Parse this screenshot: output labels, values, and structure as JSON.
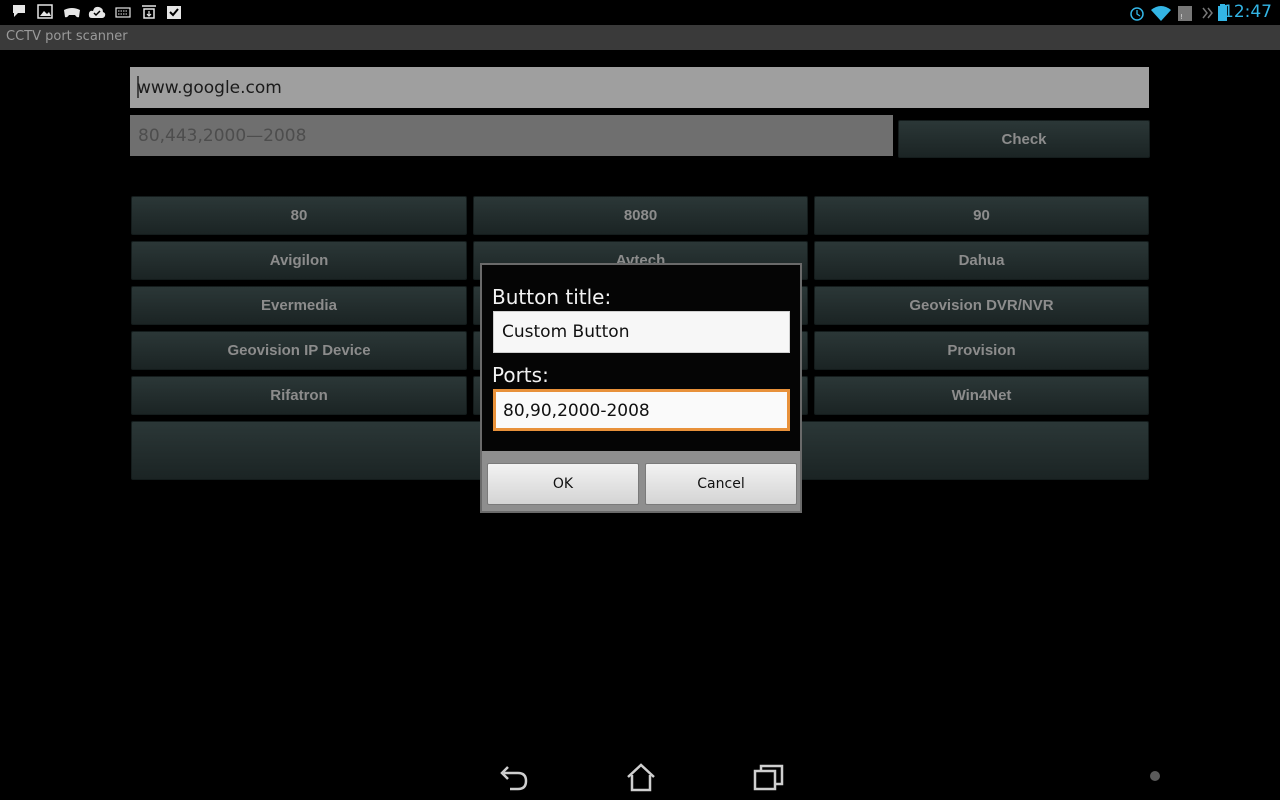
{
  "status_bar": {
    "left_icons": [
      "chat-icon",
      "image-icon",
      "game-controller-icon",
      "cloud-check-icon",
      "keyboard-icon",
      "download-icon",
      "task-check-icon"
    ],
    "right_icons": [
      "alarm-icon",
      "wifi-icon",
      "sim-icon",
      "battery-icon"
    ],
    "time": "12:47",
    "accent_color": "#33b5e5"
  },
  "app": {
    "title": "CCTV port scanner",
    "host_input": {
      "value": "www.google.com"
    },
    "ports_input": {
      "placeholder": "80,443,2000—2008"
    },
    "check_label": "Check",
    "buttons": [
      {
        "label": "80"
      },
      {
        "label": "8080"
      },
      {
        "label": "90"
      },
      {
        "label": "Avigilon"
      },
      {
        "label": "Avtech"
      },
      {
        "label": "Dahua"
      },
      {
        "label": "Evermedia"
      },
      {
        "label": ""
      },
      {
        "label": "Geovision DVR/NVR"
      },
      {
        "label": "Geovision IP Device"
      },
      {
        "label": ""
      },
      {
        "label": "Provision"
      },
      {
        "label": "Rifatron"
      },
      {
        "label": ""
      },
      {
        "label": "Win4Net"
      }
    ]
  },
  "dialog": {
    "title_label": "Button title:",
    "title_value": "Custom Button",
    "ports_label": "Ports:",
    "ports_value": "80,90,2000-2008",
    "ok_label": "OK",
    "cancel_label": "Cancel",
    "focus_color": "#e8913a"
  },
  "nav_bar": {
    "icons": [
      "back-icon",
      "home-icon",
      "recent-apps-icon",
      "dot-indicator-icon"
    ]
  }
}
